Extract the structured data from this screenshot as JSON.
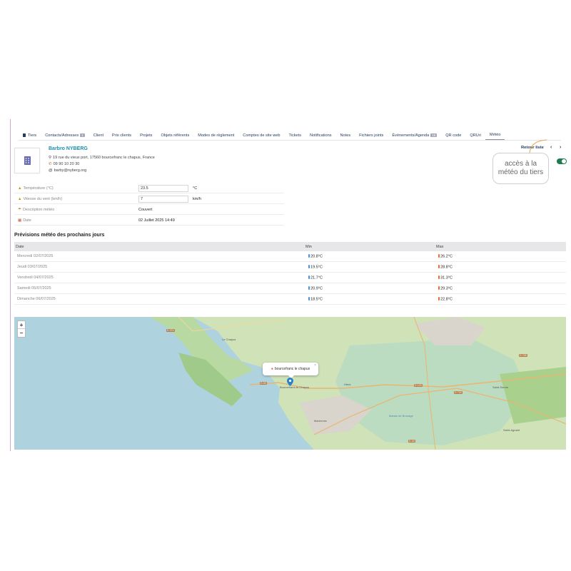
{
  "tabs": [
    {
      "label": "Tiers",
      "icon": "document-icon"
    },
    {
      "label": "Contacts/Adresses",
      "badge": "1"
    },
    {
      "label": "Client"
    },
    {
      "label": "Prix clients"
    },
    {
      "label": "Projets"
    },
    {
      "label": "Objets référents"
    },
    {
      "label": "Modes de règlement"
    },
    {
      "label": "Comptes de site web"
    },
    {
      "label": "Tickets"
    },
    {
      "label": "Notifications"
    },
    {
      "label": "Notes"
    },
    {
      "label": "Fichiers joints"
    },
    {
      "label": "Événements/Agenda",
      "badge": "16"
    },
    {
      "label": "QR code"
    },
    {
      "label": "QRUri"
    },
    {
      "label": "Météo",
      "active": true
    }
  ],
  "thirdparty": {
    "name": "Barbro NYBERG",
    "address": "19 rue du vieux port, 17560 bourcefranc le chapus, France",
    "phone": "09 90 10 20 30",
    "email": "barby@nyberg.org"
  },
  "nav": {
    "back_label": "Retour liste",
    "prev": "‹",
    "next": "›"
  },
  "callout": {
    "line1": "accès à la",
    "line2": "météo du tiers"
  },
  "meteo": {
    "temperature_label": "Température (°C)",
    "temperature_value": "23.5",
    "temperature_unit": "°C",
    "wind_label": "Vitesse du vent (km/h)",
    "wind_value": "7",
    "wind_unit": "km/h",
    "desc_label": "Description météo",
    "desc_value": "Couvert",
    "date_label": "Date",
    "date_value": "02 Juillet 2025 14:49"
  },
  "forecast": {
    "title": "Prévisions météo des prochains jours",
    "headers": [
      "Date",
      "Min",
      "Max"
    ],
    "rows": [
      {
        "date": "Mercredi 02/07/2025",
        "min": "20.8°C",
        "max": "26.2°C"
      },
      {
        "date": "Jeudi 03/07/2025",
        "min": "19.5°C",
        "max": "28.8°C"
      },
      {
        "date": "Vendredi 04/07/2025",
        "min": "21.7°C",
        "max": "31.3°C"
      },
      {
        "date": "Samedi 05/07/2025",
        "min": "20.9°C",
        "max": "29.3°C"
      },
      {
        "date": "Dimanche 06/07/2025",
        "min": "18.5°C",
        "max": "22.8°C"
      }
    ]
  },
  "map": {
    "zoom_in": "+",
    "zoom_out": "−",
    "popup_text": "bourcefranc le chapus",
    "popup_close": "×",
    "labels": [
      "Le Chapus",
      "Bourcefranc-le-Chapus",
      "Marais de Brouage",
      "Saint-Sornin",
      "Marennes",
      "Hiers",
      "Saint-Agnant"
    ],
    "roads": [
      "D 274",
      "D 26",
      "D 123",
      "D 733",
      "D 18",
      "D 728"
    ]
  }
}
